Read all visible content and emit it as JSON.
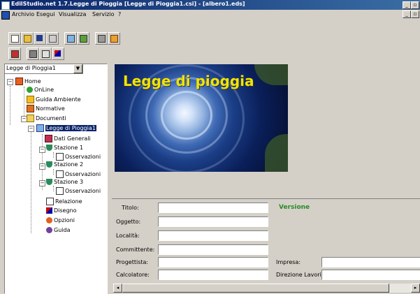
{
  "window": {
    "title": "EdilStudio.net 1.7.Legge di Pioggia [Legge di Pioggia1.csi] - [albero1.eds]"
  },
  "menu": [
    "Archivio",
    "Esegui",
    "Visualizza",
    "Servizio",
    "?"
  ],
  "tree_combo": {
    "value": "Legge di Pioggia1"
  },
  "tree": {
    "home": "Home",
    "online": "OnLine",
    "guida_ambiente": "Guida Ambiente",
    "normative": "Normative",
    "documenti": "Documenti",
    "legge": "Legge di Pioggia1",
    "dati_generali": "Dati Generali",
    "stazione1": "Stazione 1",
    "oss1": "Osservazioni",
    "stazione2": "Stazione 2",
    "oss2": "Osservazioni",
    "stazione3": "Stazione 3",
    "oss3": "Osservazioni",
    "relazione": "Relazione",
    "disegno": "Disegno",
    "opzioni": "Opzioni",
    "guida": "Guida"
  },
  "banner": {
    "title": "Legge di pioggia"
  },
  "form": {
    "titolo": "Titolo:",
    "versione": "Versione",
    "oggetto": "Oggetto:",
    "localita": "Località:",
    "committente": "Committente:",
    "progettista": "Progettista:",
    "impresa": "Impresa:",
    "calcolatore": "Calcolatore:",
    "direzione": "Direzione Lavori:"
  },
  "icons": {
    "window_min": "_",
    "window_max": "▫",
    "combo_arrow": "▼",
    "scroll_left": "◂",
    "scroll_right": "▸",
    "expand_minus": "−"
  }
}
